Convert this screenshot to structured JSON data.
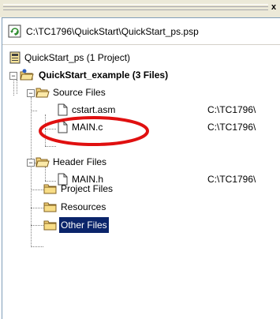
{
  "window": {
    "close_glyph": "x"
  },
  "project_path": "C:\\TC1796\\QuickStart\\QuickStart_ps.psp",
  "tree": {
    "root": {
      "label": "QuickStart_ps (1 Project)"
    },
    "project": {
      "label": "QuickStart_example (3 Files)"
    },
    "source_files": {
      "label": "Source Files",
      "items": [
        {
          "label": "cstart.asm",
          "path": "C:\\TC1796\\"
        },
        {
          "label": "MAIN.c",
          "path": "C:\\TC1796\\"
        }
      ]
    },
    "header_files": {
      "label": "Header Files",
      "items": [
        {
          "label": "MAIN.h",
          "path": "C:\\TC1796\\"
        }
      ]
    },
    "project_files": {
      "label": "Project Files"
    },
    "resources": {
      "label": "Resources"
    },
    "other_files": {
      "label": "Other Files"
    }
  },
  "annotation": {
    "color": "#e01010"
  },
  "colors": {
    "selection": "#0a246a",
    "folder": "#f4d27a"
  }
}
